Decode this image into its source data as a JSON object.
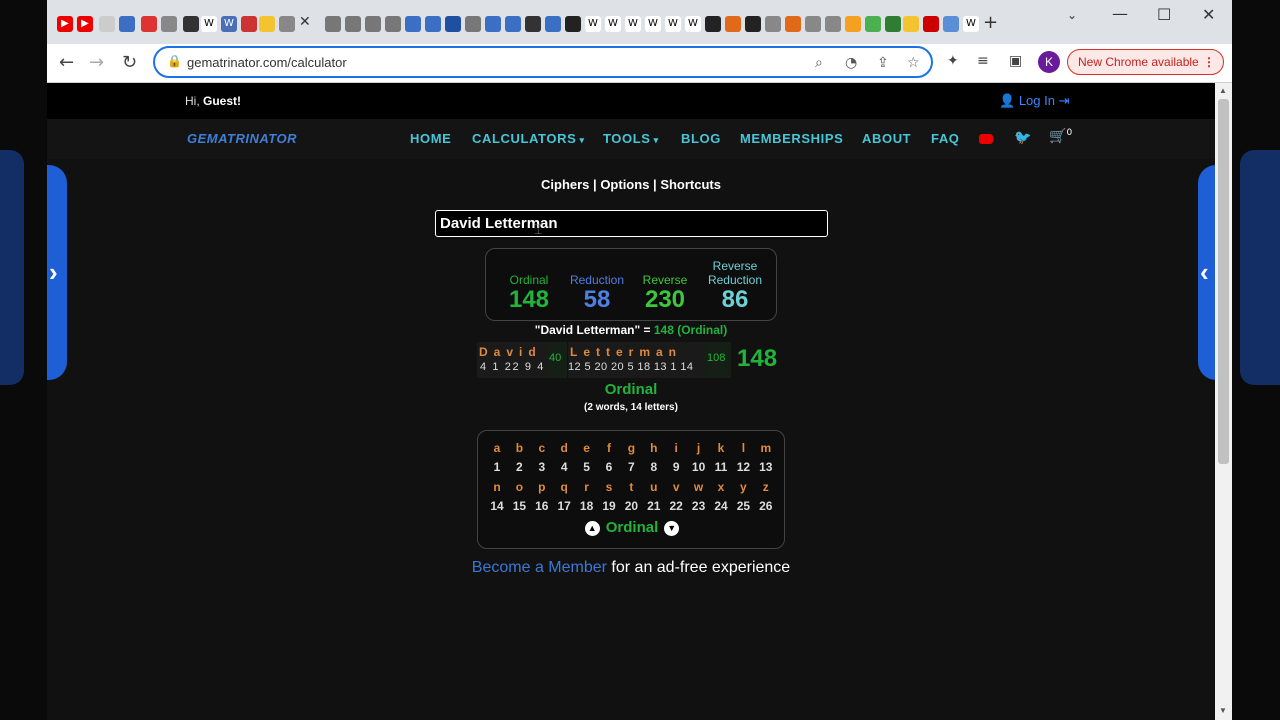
{
  "browser": {
    "url": "gematrinator.com/calculator",
    "profile_initial": "K",
    "update_label": "New Chrome available"
  },
  "page": {
    "greeting_prefix": "Hi,",
    "greeting_user": "Guest!",
    "login_label": "Log In",
    "logo_text": "GEMATRINATOR",
    "nav": {
      "home": "HOME",
      "calculators": "CALCULATORS",
      "tools": "TOOLS",
      "blog": "BLOG",
      "memberships": "MEMBERSHIPS",
      "about": "ABOUT",
      "faq": "FAQ",
      "cart_count": "0"
    },
    "sublinks": {
      "ciphers": "Ciphers",
      "options": "Options",
      "shortcuts": "Shortcuts",
      "separator": "|"
    },
    "phrase_input": "David Letterman",
    "ciphers": [
      {
        "label": "Ordinal",
        "value": "148",
        "color": "#22b33a"
      },
      {
        "label": "Reduction",
        "value": "58",
        "color": "#4f7fe0"
      },
      {
        "label": "Reverse",
        "value": "230",
        "color": "#3cc83c"
      },
      {
        "label": "Reverse Reduction",
        "value": "86",
        "color": "#6fd0d6"
      }
    ],
    "summary": {
      "phrase": "\"David Letterman\"",
      "equals": "=",
      "result": "148 (Ordinal)"
    },
    "breakdown": {
      "word1_letters": "David",
      "word1_values": "4 1 22 9 4",
      "word1_subtotal": "40",
      "word2_letters": "Letterman",
      "word2_values": "12 5 20 20 5 18 13 1 14",
      "word2_subtotal": "108",
      "total": "148"
    },
    "cipher_name": "Ordinal",
    "word_count": "(2 words, 14 letters)",
    "chart": {
      "row1_letters": [
        "a",
        "b",
        "c",
        "d",
        "e",
        "f",
        "g",
        "h",
        "i",
        "j",
        "k",
        "l",
        "m"
      ],
      "row1_values": [
        "1",
        "2",
        "3",
        "4",
        "5",
        "6",
        "7",
        "8",
        "9",
        "10",
        "11",
        "12",
        "13"
      ],
      "row2_letters": [
        "n",
        "o",
        "p",
        "q",
        "r",
        "s",
        "t",
        "u",
        "v",
        "w",
        "x",
        "y",
        "z"
      ],
      "row2_values": [
        "14",
        "15",
        "16",
        "17",
        "18",
        "19",
        "20",
        "21",
        "22",
        "23",
        "24",
        "25",
        "26"
      ],
      "name": "Ordinal"
    },
    "promo": {
      "link": "Become a Member",
      "text": "for an ad-free experience"
    }
  }
}
